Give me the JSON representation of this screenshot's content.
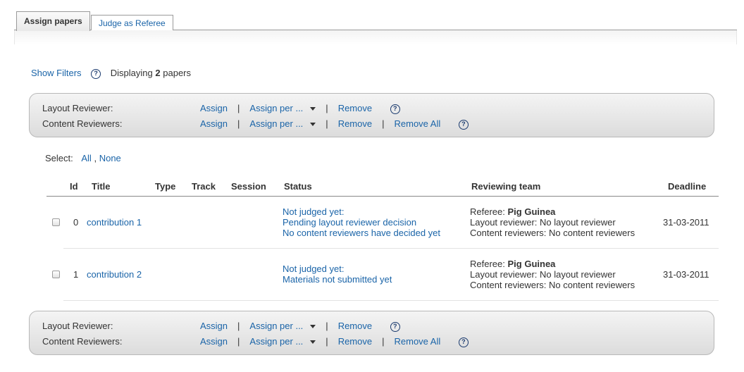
{
  "tabs": [
    {
      "label": "Assign papers",
      "active": true
    },
    {
      "label": "Judge as Referee",
      "active": false
    }
  ],
  "filters": {
    "show_filters": "Show Filters",
    "help": "?",
    "displaying_prefix": "Displaying",
    "count": "2",
    "displaying_suffix": "papers"
  },
  "actions": {
    "layout_label": "Layout Reviewer:",
    "content_label": "Content Reviewers:",
    "assign": "Assign",
    "assign_per": "Assign per ...",
    "separator": "|",
    "remove": "Remove",
    "remove_all": "Remove All",
    "help": "?"
  },
  "select": {
    "label": "Select:",
    "all": "All",
    "comma": ",",
    "none": "None"
  },
  "table": {
    "headers": {
      "id": "Id",
      "title": "Title",
      "type": "Type",
      "track": "Track",
      "session": "Session",
      "status": "Status",
      "team": "Reviewing team",
      "deadline": "Deadline"
    },
    "rows": [
      {
        "id": "0",
        "title": "contribution 1",
        "status": [
          "Not judged yet:",
          "Pending layout reviewer decision",
          "No content reviewers have decided yet"
        ],
        "referee_label": "Referee:",
        "referee": "Pig Guinea",
        "layout_reviewer": "Layout reviewer: No layout reviewer",
        "content_reviewers": "Content reviewers: No content reviewers",
        "deadline": "31-03-2011"
      },
      {
        "id": "1",
        "title": "contribution 2",
        "status": [
          "Not judged yet:",
          "Materials not submitted yet"
        ],
        "referee_label": "Referee:",
        "referee": "Pig Guinea",
        "layout_reviewer": "Layout reviewer: No layout reviewer",
        "content_reviewers": "Content reviewers: No content reviewers",
        "deadline": "31-03-2011"
      }
    ]
  },
  "colors": {
    "link": "#1a64a8",
    "text": "#333333",
    "box_top": "#f4f4f4",
    "box_bottom": "#dcdcdc"
  }
}
